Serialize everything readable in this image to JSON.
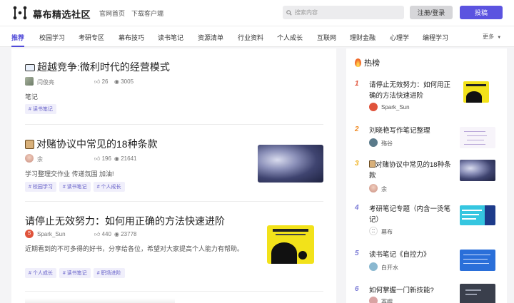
{
  "header": {
    "site_name": "幕布精选社区",
    "links": [
      "官网首页",
      "下载客户端"
    ],
    "search_placeholder": "搜索内容",
    "login_label": "注册/登录",
    "post_label": "投稿"
  },
  "nav": {
    "items": [
      "推荐",
      "校园学习",
      "考研专区",
      "幕布技巧",
      "读书笔记",
      "资源清单",
      "行业资料",
      "个人成长",
      "互联网",
      "理财金融",
      "心理学",
      "编程学习"
    ],
    "more_label": "更多"
  },
  "articles": [
    {
      "title": "超越竞争:微利时代的经营模式",
      "author": "闫俊亮",
      "likes": "26",
      "views": "3005",
      "summary": "笔记",
      "tags": [
        "# 读书笔记"
      ]
    },
    {
      "title": "对赌协议中常见的18种条款",
      "author": "余",
      "likes": "196",
      "views": "21641",
      "summary": "学习整理交作业 传递氛围 加油!",
      "tags": [
        "# 校园学习",
        "# 读书笔记",
        "# 个人成长"
      ]
    },
    {
      "title": "请停止无效努力：如何用正确的方法快速进阶",
      "author": "Spark_Sun",
      "likes": "440",
      "views": "23778",
      "summary": "近期看到的不可多得的好书，分享给各位，希望对大家提高个人能力有帮助。",
      "tags": [
        "# 个人成长",
        "# 读书笔记",
        "# 职场进阶"
      ]
    }
  ],
  "hot": {
    "title": "热榜",
    "items": [
      {
        "rank": "1",
        "title": "请停止无效努力：如何用正确的方法快速进阶",
        "author": "Spark_Sun"
      },
      {
        "rank": "2",
        "title": "刘晓艳写作笔记整理",
        "author": "殇谷"
      },
      {
        "rank": "3",
        "title": "对赌协议中常见的18种条款",
        "author": "余"
      },
      {
        "rank": "4",
        "title": "考研笔记专题（内含一烫笔记）",
        "author": "幕布"
      },
      {
        "rank": "5",
        "title": "读书笔记《自控力》",
        "author": "白开水"
      },
      {
        "rank": "6",
        "title": "如何掌握一门新技能?",
        "author": "寡嘤"
      }
    ]
  },
  "colors": {
    "accent": "#5b53e0",
    "rank1": "#e0533b",
    "rank2": "#f08a24",
    "rank3": "#f0b323",
    "rank_other": "#7b7bd6"
  }
}
